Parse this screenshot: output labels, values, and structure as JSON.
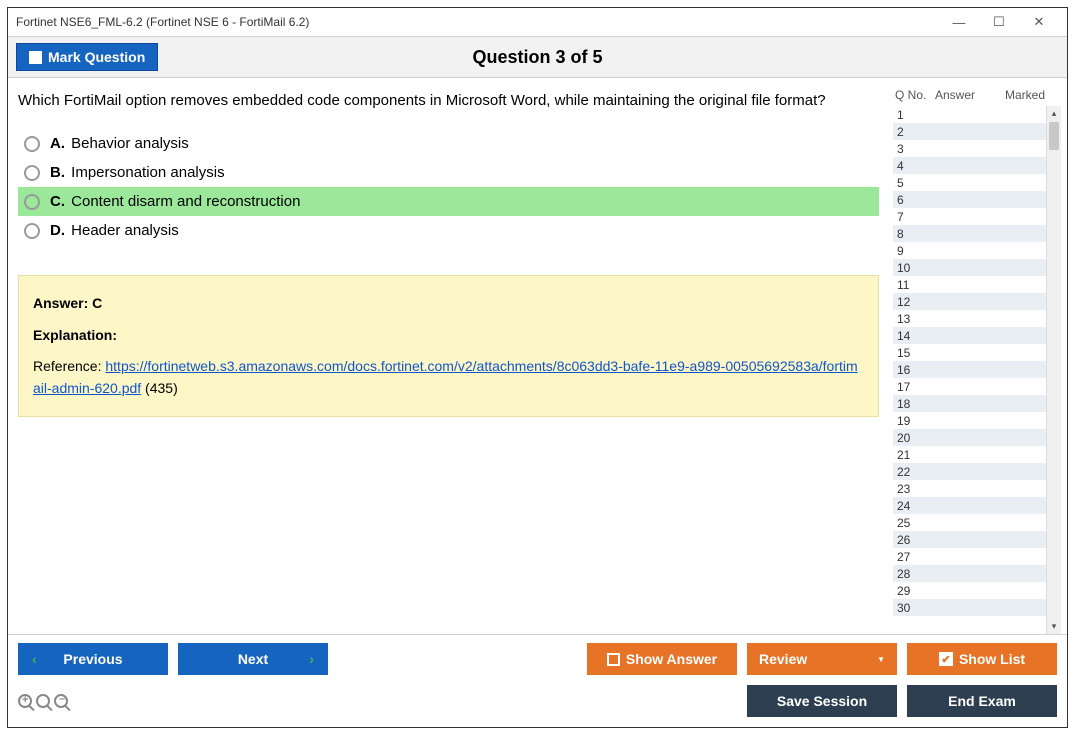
{
  "window_title": "Fortinet NSE6_FML-6.2 (Fortinet NSE 6 - FortiMail 6.2)",
  "header": {
    "mark_label": "Mark Question",
    "question_title": "Question 3 of 5"
  },
  "question": {
    "text": "Which FortiMail option removes embedded code components in Microsoft Word, while maintaining the original file format?",
    "options": [
      {
        "letter": "A.",
        "text": "Behavior analysis",
        "correct": false
      },
      {
        "letter": "B.",
        "text": "Impersonation analysis",
        "correct": false
      },
      {
        "letter": "C.",
        "text": "Content disarm and reconstruction",
        "correct": true
      },
      {
        "letter": "D.",
        "text": "Header analysis",
        "correct": false
      }
    ]
  },
  "answer_box": {
    "answer_label": "Answer: C",
    "explanation_label": "Explanation:",
    "ref_prefix": "Reference: ",
    "ref_link": "https://fortinetweb.s3.amazonaws.com/docs.fortinet.com/v2/attachments/8c063dd3-bafe-11e9-a989-00505692583a/fortimail-admin-620.pdf",
    "ref_suffix": " (435)"
  },
  "sidebar": {
    "col_q": "Q No.",
    "col_a": "Answer",
    "col_m": "Marked",
    "rows": [
      "1",
      "2",
      "3",
      "4",
      "5",
      "6",
      "7",
      "8",
      "9",
      "10",
      "11",
      "12",
      "13",
      "14",
      "15",
      "16",
      "17",
      "18",
      "19",
      "20",
      "21",
      "22",
      "23",
      "24",
      "25",
      "26",
      "27",
      "28",
      "29",
      "30"
    ]
  },
  "footer": {
    "previous": "Previous",
    "next": "Next",
    "show_answer": "Show Answer",
    "review": "Review",
    "show_list": "Show List",
    "save_session": "Save Session",
    "end_exam": "End Exam"
  }
}
